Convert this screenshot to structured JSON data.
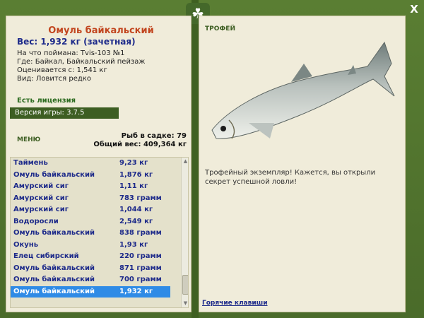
{
  "window": {
    "close_glyph": "X",
    "badge_icon": "leaf-icon"
  },
  "fish": {
    "name": "Омуль байкальский",
    "weight_line": "Вес: 1,932 кг (зачетная)",
    "info": [
      "На что поймана: Tvis-103 №1",
      "Где: Байкал, Байкальский пейзаж",
      "Оценивается с: 1,541 кг",
      "Вид: Ловится редко"
    ]
  },
  "license": "Есть лицензия",
  "version": "Версия игры: 3.7.5",
  "menu_label": "МЕНЮ",
  "stats": {
    "count_line": "Рыб в садке: 79",
    "total_line": "Общий вес: 409,364 кг"
  },
  "catch_list": [
    {
      "name": "Таймень",
      "weight": "9,23 кг"
    },
    {
      "name": "Омуль байкальский",
      "weight": "1,876 кг"
    },
    {
      "name": "Амурский сиг",
      "weight": "1,11 кг"
    },
    {
      "name": "Амурский сиг",
      "weight": "783 грамм"
    },
    {
      "name": "Амурский сиг",
      "weight": "1,044 кг"
    },
    {
      "name": "Водоросли",
      "weight": "2,549 кг"
    },
    {
      "name": "Омуль байкальский",
      "weight": "838 грамм"
    },
    {
      "name": "Окунь",
      "weight": "1,93 кг"
    },
    {
      "name": "Елец сибирский",
      "weight": "220 грамм"
    },
    {
      "name": "Омуль байкальский",
      "weight": "871 грамм"
    },
    {
      "name": "Омуль байкальский",
      "weight": "700 грамм"
    },
    {
      "name": "Омуль байкальский",
      "weight": "1,932 кг"
    }
  ],
  "selected_index": 11,
  "trophy": {
    "label": "ТРОФЕЙ",
    "text": "Трофейный экземпляр! Кажется, вы открыли секрет успешной ловли!"
  },
  "hotkeys": "Горячие клавиши",
  "colors": {
    "frame_green": "#4c6e2c",
    "panel_bg": "#f0ecda",
    "fish_name_red": "#c2451e",
    "text_blue": "#1d2a8a",
    "selection_blue": "#2f8be6"
  }
}
